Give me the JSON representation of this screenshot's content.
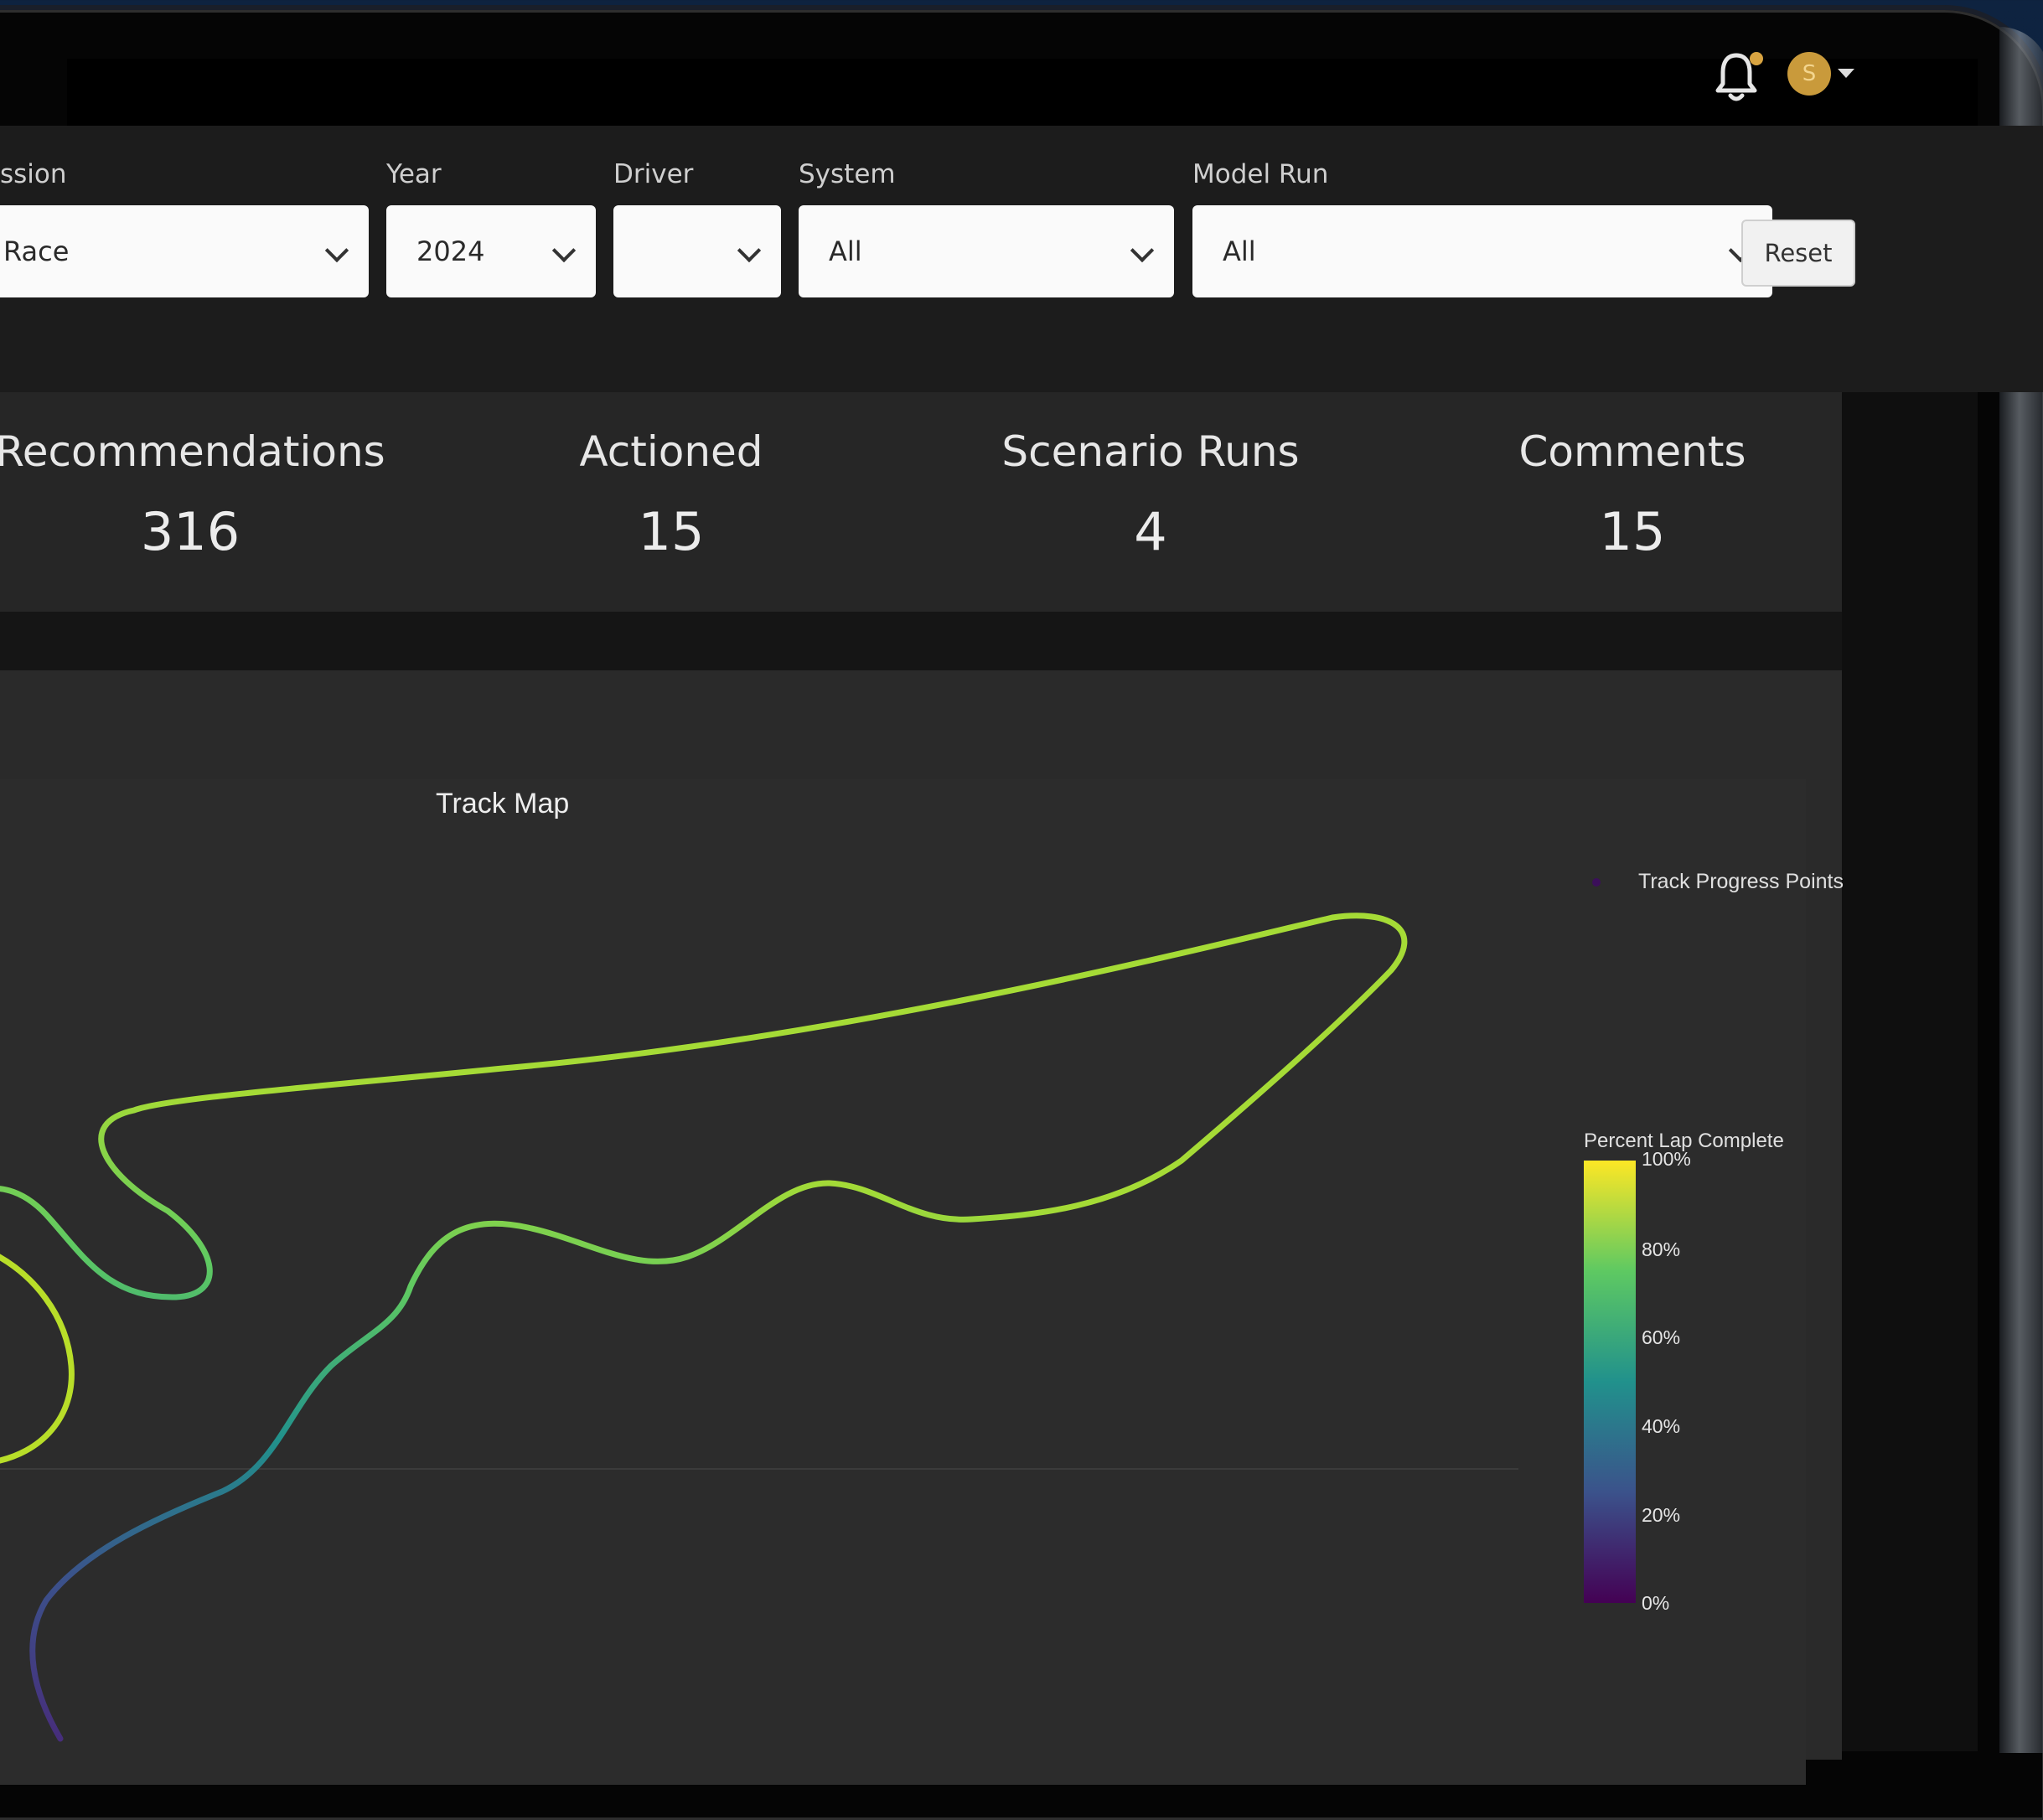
{
  "header": {
    "avatar_initial": "S"
  },
  "filters": {
    "session": {
      "label": "ssion",
      "value": "Race"
    },
    "year": {
      "label": "Year",
      "value": "2024"
    },
    "driver": {
      "label": "Driver",
      "value": ""
    },
    "system": {
      "label": "System",
      "value": "All"
    },
    "model_run": {
      "label": "Model Run",
      "value": "All"
    },
    "reset_label": "Reset"
  },
  "stats": [
    {
      "label": "Recommendations",
      "value": "316"
    },
    {
      "label": "Actioned",
      "value": "15"
    },
    {
      "label": "Scenario Runs",
      "value": "4"
    },
    {
      "label": "Comments",
      "value": "15"
    }
  ],
  "chart": {
    "title": "Track Map",
    "legend_label": "Track Progress Points",
    "colorbar_title": "Percent Lap Complete",
    "colorbar_ticks": [
      "100%",
      "80%",
      "60%",
      "40%",
      "20%",
      "0%"
    ],
    "colorscale": [
      "#440154",
      "#3b528b",
      "#21918c",
      "#5ec962",
      "#fde725"
    ]
  },
  "chart_data": {
    "type": "scatter",
    "title": "Track Map",
    "series": [
      {
        "name": "Track Progress Points",
        "color_by": "Percent Lap Complete"
      }
    ],
    "colorbar": {
      "title": "Percent Lap Complete",
      "range": [
        0,
        100
      ],
      "ticks": [
        "0%",
        "20%",
        "40%",
        "60%",
        "80%",
        "100%"
      ]
    },
    "legend": "top-right"
  }
}
